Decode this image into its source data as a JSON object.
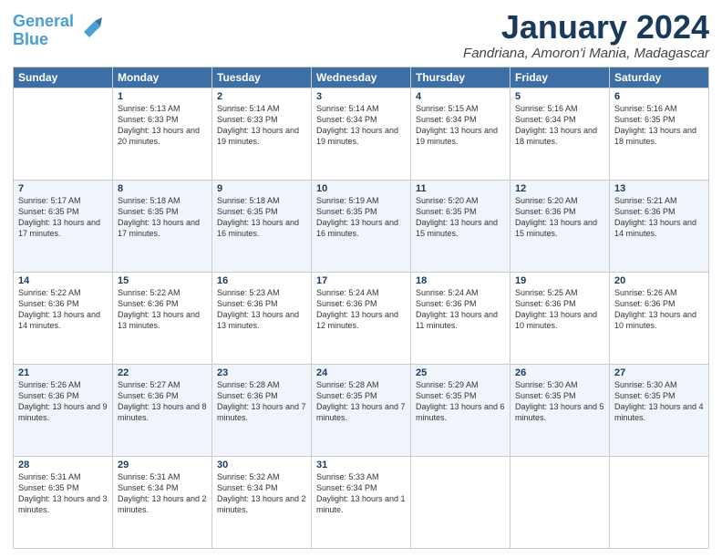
{
  "header": {
    "logo_line1": "General",
    "logo_line2": "Blue",
    "title": "January 2024",
    "location": "Fandriana, Amoron'i Mania, Madagascar"
  },
  "days_of_week": [
    "Sunday",
    "Monday",
    "Tuesday",
    "Wednesday",
    "Thursday",
    "Friday",
    "Saturday"
  ],
  "weeks": [
    [
      {
        "day": "",
        "sunrise": "",
        "sunset": "",
        "daylight": ""
      },
      {
        "day": "1",
        "sunrise": "Sunrise: 5:13 AM",
        "sunset": "Sunset: 6:33 PM",
        "daylight": "Daylight: 13 hours and 20 minutes."
      },
      {
        "day": "2",
        "sunrise": "Sunrise: 5:14 AM",
        "sunset": "Sunset: 6:33 PM",
        "daylight": "Daylight: 13 hours and 19 minutes."
      },
      {
        "day": "3",
        "sunrise": "Sunrise: 5:14 AM",
        "sunset": "Sunset: 6:34 PM",
        "daylight": "Daylight: 13 hours and 19 minutes."
      },
      {
        "day": "4",
        "sunrise": "Sunrise: 5:15 AM",
        "sunset": "Sunset: 6:34 PM",
        "daylight": "Daylight: 13 hours and 19 minutes."
      },
      {
        "day": "5",
        "sunrise": "Sunrise: 5:16 AM",
        "sunset": "Sunset: 6:34 PM",
        "daylight": "Daylight: 13 hours and 18 minutes."
      },
      {
        "day": "6",
        "sunrise": "Sunrise: 5:16 AM",
        "sunset": "Sunset: 6:35 PM",
        "daylight": "Daylight: 13 hours and 18 minutes."
      }
    ],
    [
      {
        "day": "7",
        "sunrise": "Sunrise: 5:17 AM",
        "sunset": "Sunset: 6:35 PM",
        "daylight": "Daylight: 13 hours and 17 minutes."
      },
      {
        "day": "8",
        "sunrise": "Sunrise: 5:18 AM",
        "sunset": "Sunset: 6:35 PM",
        "daylight": "Daylight: 13 hours and 17 minutes."
      },
      {
        "day": "9",
        "sunrise": "Sunrise: 5:18 AM",
        "sunset": "Sunset: 6:35 PM",
        "daylight": "Daylight: 13 hours and 16 minutes."
      },
      {
        "day": "10",
        "sunrise": "Sunrise: 5:19 AM",
        "sunset": "Sunset: 6:35 PM",
        "daylight": "Daylight: 13 hours and 16 minutes."
      },
      {
        "day": "11",
        "sunrise": "Sunrise: 5:20 AM",
        "sunset": "Sunset: 6:35 PM",
        "daylight": "Daylight: 13 hours and 15 minutes."
      },
      {
        "day": "12",
        "sunrise": "Sunrise: 5:20 AM",
        "sunset": "Sunset: 6:36 PM",
        "daylight": "Daylight: 13 hours and 15 minutes."
      },
      {
        "day": "13",
        "sunrise": "Sunrise: 5:21 AM",
        "sunset": "Sunset: 6:36 PM",
        "daylight": "Daylight: 13 hours and 14 minutes."
      }
    ],
    [
      {
        "day": "14",
        "sunrise": "Sunrise: 5:22 AM",
        "sunset": "Sunset: 6:36 PM",
        "daylight": "Daylight: 13 hours and 14 minutes."
      },
      {
        "day": "15",
        "sunrise": "Sunrise: 5:22 AM",
        "sunset": "Sunset: 6:36 PM",
        "daylight": "Daylight: 13 hours and 13 minutes."
      },
      {
        "day": "16",
        "sunrise": "Sunrise: 5:23 AM",
        "sunset": "Sunset: 6:36 PM",
        "daylight": "Daylight: 13 hours and 13 minutes."
      },
      {
        "day": "17",
        "sunrise": "Sunrise: 5:24 AM",
        "sunset": "Sunset: 6:36 PM",
        "daylight": "Daylight: 13 hours and 12 minutes."
      },
      {
        "day": "18",
        "sunrise": "Sunrise: 5:24 AM",
        "sunset": "Sunset: 6:36 PM",
        "daylight": "Daylight: 13 hours and 11 minutes."
      },
      {
        "day": "19",
        "sunrise": "Sunrise: 5:25 AM",
        "sunset": "Sunset: 6:36 PM",
        "daylight": "Daylight: 13 hours and 10 minutes."
      },
      {
        "day": "20",
        "sunrise": "Sunrise: 5:26 AM",
        "sunset": "Sunset: 6:36 PM",
        "daylight": "Daylight: 13 hours and 10 minutes."
      }
    ],
    [
      {
        "day": "21",
        "sunrise": "Sunrise: 5:26 AM",
        "sunset": "Sunset: 6:36 PM",
        "daylight": "Daylight: 13 hours and 9 minutes."
      },
      {
        "day": "22",
        "sunrise": "Sunrise: 5:27 AM",
        "sunset": "Sunset: 6:36 PM",
        "daylight": "Daylight: 13 hours and 8 minutes."
      },
      {
        "day": "23",
        "sunrise": "Sunrise: 5:28 AM",
        "sunset": "Sunset: 6:36 PM",
        "daylight": "Daylight: 13 hours and 7 minutes."
      },
      {
        "day": "24",
        "sunrise": "Sunrise: 5:28 AM",
        "sunset": "Sunset: 6:35 PM",
        "daylight": "Daylight: 13 hours and 7 minutes."
      },
      {
        "day": "25",
        "sunrise": "Sunrise: 5:29 AM",
        "sunset": "Sunset: 6:35 PM",
        "daylight": "Daylight: 13 hours and 6 minutes."
      },
      {
        "day": "26",
        "sunrise": "Sunrise: 5:30 AM",
        "sunset": "Sunset: 6:35 PM",
        "daylight": "Daylight: 13 hours and 5 minutes."
      },
      {
        "day": "27",
        "sunrise": "Sunrise: 5:30 AM",
        "sunset": "Sunset: 6:35 PM",
        "daylight": "Daylight: 13 hours and 4 minutes."
      }
    ],
    [
      {
        "day": "28",
        "sunrise": "Sunrise: 5:31 AM",
        "sunset": "Sunset: 6:35 PM",
        "daylight": "Daylight: 13 hours and 3 minutes."
      },
      {
        "day": "29",
        "sunrise": "Sunrise: 5:31 AM",
        "sunset": "Sunset: 6:34 PM",
        "daylight": "Daylight: 13 hours and 2 minutes."
      },
      {
        "day": "30",
        "sunrise": "Sunrise: 5:32 AM",
        "sunset": "Sunset: 6:34 PM",
        "daylight": "Daylight: 13 hours and 2 minutes."
      },
      {
        "day": "31",
        "sunrise": "Sunrise: 5:33 AM",
        "sunset": "Sunset: 6:34 PM",
        "daylight": "Daylight: 13 hours and 1 minute."
      },
      {
        "day": "",
        "sunrise": "",
        "sunset": "",
        "daylight": ""
      },
      {
        "day": "",
        "sunrise": "",
        "sunset": "",
        "daylight": ""
      },
      {
        "day": "",
        "sunrise": "",
        "sunset": "",
        "daylight": ""
      }
    ]
  ]
}
